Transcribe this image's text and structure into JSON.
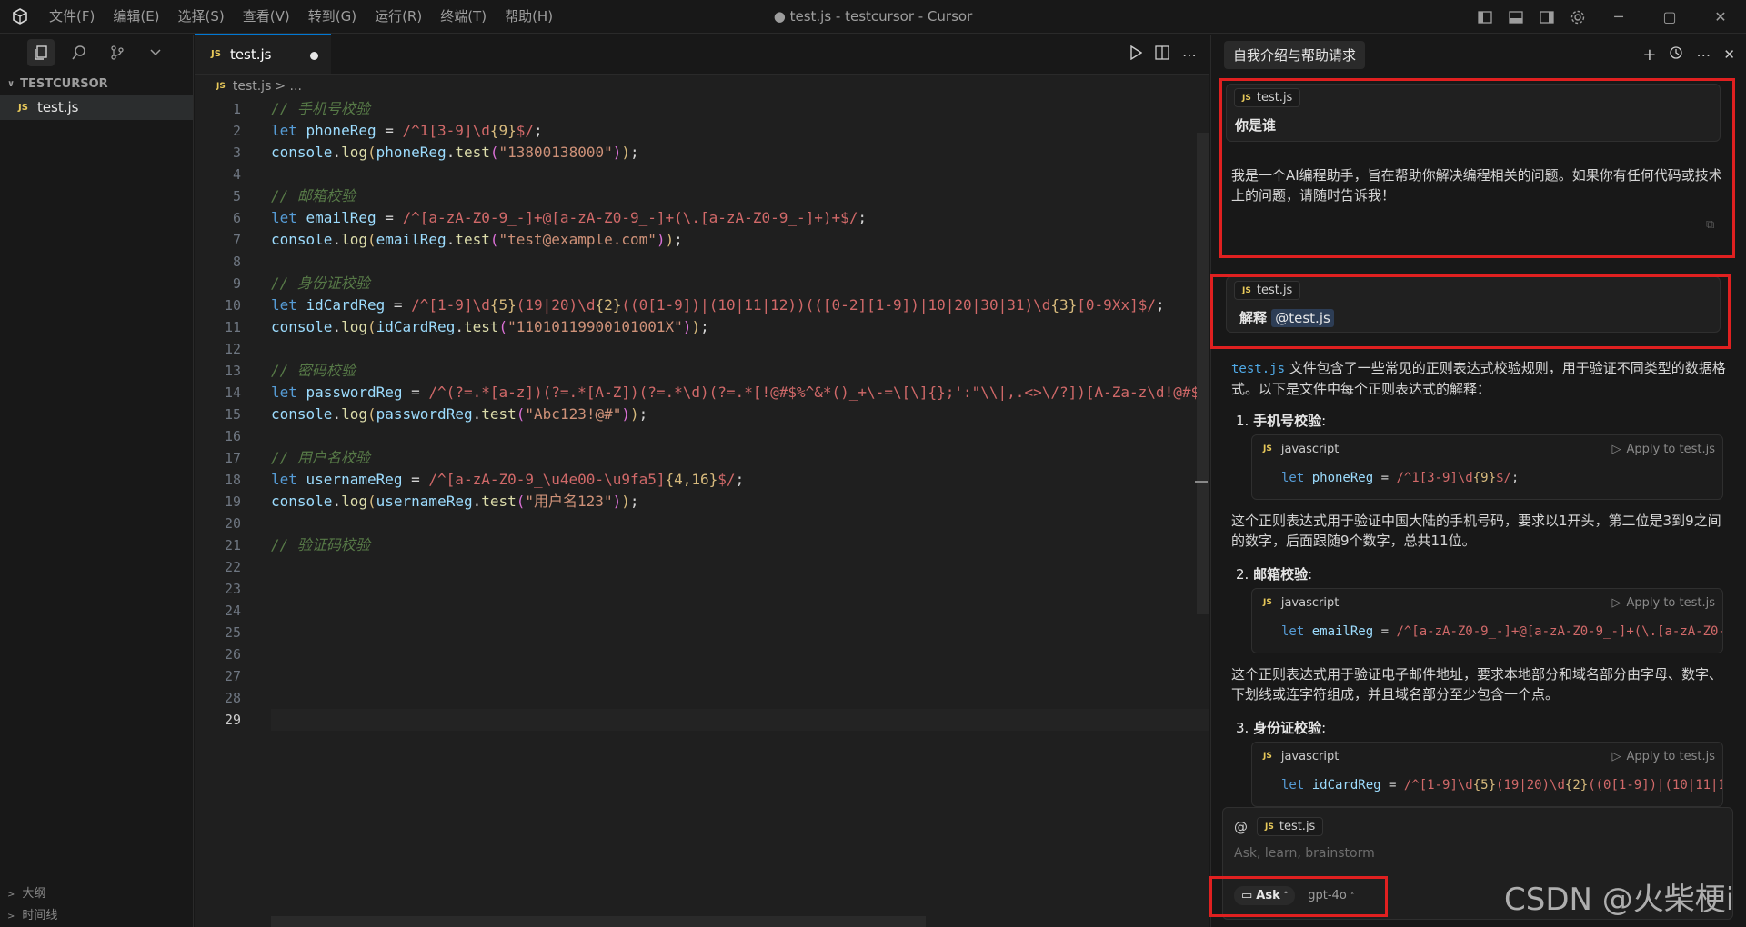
{
  "titlebar": {
    "menu": [
      "文件(F)",
      "编辑(E)",
      "选择(S)",
      "查看(V)",
      "转到(G)",
      "运行(R)",
      "终端(T)",
      "帮助(H)"
    ],
    "window_title": "● test.js - testcursor - Cursor"
  },
  "sidebar": {
    "section_title": "TESTCURSOR",
    "file_name": "test.js",
    "file_badge": "JS",
    "outline_label": "大纲",
    "timeline_label": "时间线"
  },
  "editor": {
    "tab_label": "test.js",
    "tab_badge": "JS",
    "breadcrumb_file": "test.js",
    "breadcrumb_rest": "> ...",
    "current_line": 29,
    "line_numbers": [
      "1",
      "2",
      "3",
      "4",
      "5",
      "6",
      "7",
      "8",
      "9",
      "10",
      "11",
      "12",
      "13",
      "14",
      "15",
      "16",
      "17",
      "18",
      "19",
      "20",
      "21",
      "22",
      "23",
      "24",
      "25",
      "26",
      "27",
      "28",
      "29"
    ],
    "lines": [
      "// 手机号校验",
      "let phoneReg = /^1[3-9]\\d{9}$/;",
      "console.log(phoneReg.test(\"13800138000\"));",
      "",
      "// 邮箱校验",
      "let emailReg = /^[a-zA-Z0-9_-]+@[a-zA-Z0-9_-]+(\\.[a-zA-Z0-9_-]+)+$/;",
      "console.log(emailReg.test(\"test@example.com\"));",
      "",
      "// 身份证校验",
      "let idCardReg = /^[1-9]\\d{5}(19|20)\\d{2}((0[1-9])|(10|11|12))(([0-2][1-9])|10|20|30|31)\\d{3}[0-9Xx]$/;",
      "console.log(idCardReg.test(\"11010119900101001X\"));",
      "",
      "// 密码校验",
      "let passwordReg = /^(?=.*[a-z])(?=.*[A-Z])(?=.*\\d)(?=.*[!@#$%^&*()_+\\-=\\[\\]{};':\"\\\\|,.<>\\/?])[A-Za-z\\d!@#$%^",
      "console.log(passwordReg.test(\"Abc123!@#\"));",
      "",
      "// 用户名校验",
      "let usernameReg = /^[a-zA-Z0-9_\\u4e00-\\u9fa5]{4,16}$/;",
      "console.log(usernameReg.test(\"用户名123\"));",
      "",
      "// 验证码校验",
      "",
      "",
      "",
      "",
      "",
      "",
      "",
      ""
    ]
  },
  "chat": {
    "title": "自我介绍与帮助请求",
    "msg1_chip": "test.js",
    "msg1_text": "你是谁",
    "reply1": "我是一个AI编程助手，旨在帮助你解决编程相关的问题。如果你有任何代码或技术上的问题，请随时告诉我！",
    "msg2_chip": "test.js",
    "msg2_text": "解释",
    "msg2_mention": "@test.js",
    "reply2_file": "test.js",
    "reply2_intro": " 文件包含了一些常见的正则表达式校验规则，用于验证不同类型的数据格式。以下是文件中每个正则表达式的解释：",
    "items": [
      {
        "num": "1.",
        "title": "手机号校验",
        "colon": ":",
        "lang": "javascript",
        "apply": "Apply to test.js",
        "code": "let phoneReg = /^1[3-9]\\d{9}$/;",
        "desc": "这个正则表达式用于验证中国大陆的手机号码，要求以1开头，第二位是3到9之间的数字，后面跟随9个数字，总共11位。"
      },
      {
        "num": "2.",
        "title": "邮箱校验",
        "colon": ":",
        "lang": "javascript",
        "apply": "Apply to test.js",
        "code": "let emailReg = /^[a-zA-Z0-9_-]+@[a-zA-Z0-9_-]+(\\.[a-zA-Z0-9_-",
        "desc": "这个正则表达式用于验证电子邮件地址，要求本地部分和域名部分由字母、数字、下划线或连字符组成，并且域名部分至少包含一个点。"
      },
      {
        "num": "3.",
        "title": "身份证校验",
        "colon": ":",
        "lang": "javascript",
        "apply": "Apply to test.js",
        "code": "let idCardReg = /^[1-9]\\d{5}(19|20)\\d{2}((0[1-9])|(10|11|1",
        "desc": ""
      }
    ],
    "input_chip": "test.js",
    "input_placeholder": "Ask, learn, brainstorm",
    "mode_label": "Ask",
    "model_label": "gpt-4o"
  },
  "watermark": "CSDN @火柴梗i",
  "colors": {
    "highlight": "#e02020",
    "accent": "#0078d4",
    "js_badge": "#e8c95a"
  }
}
